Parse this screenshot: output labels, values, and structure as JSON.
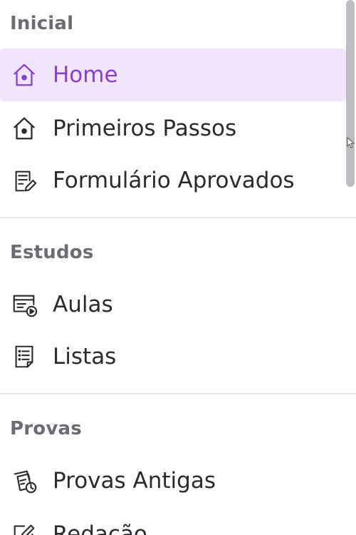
{
  "sections": {
    "inicial": {
      "title": "Inicial",
      "items": [
        {
          "label": "Home",
          "icon": "home-icon",
          "active": true
        },
        {
          "label": "Primeiros Passos",
          "icon": "home-outline-icon",
          "active": false
        },
        {
          "label": "Formulário Aprovados",
          "icon": "form-edit-icon",
          "active": false
        }
      ]
    },
    "estudos": {
      "title": "Estudos",
      "items": [
        {
          "label": "Aulas",
          "icon": "video-lesson-icon"
        },
        {
          "label": "Listas",
          "icon": "list-icon"
        }
      ]
    },
    "provas": {
      "title": "Provas",
      "items": [
        {
          "label": "Provas Antigas",
          "icon": "exam-history-icon"
        },
        {
          "label": "Redação",
          "icon": "pencil-edit-icon"
        }
      ]
    }
  },
  "colors": {
    "accent": "#8d3dd6",
    "active_bg": "#f1e4fd",
    "section_title": "#6b6b73",
    "text": "#2a2a30",
    "divider": "#e6e6ea"
  }
}
